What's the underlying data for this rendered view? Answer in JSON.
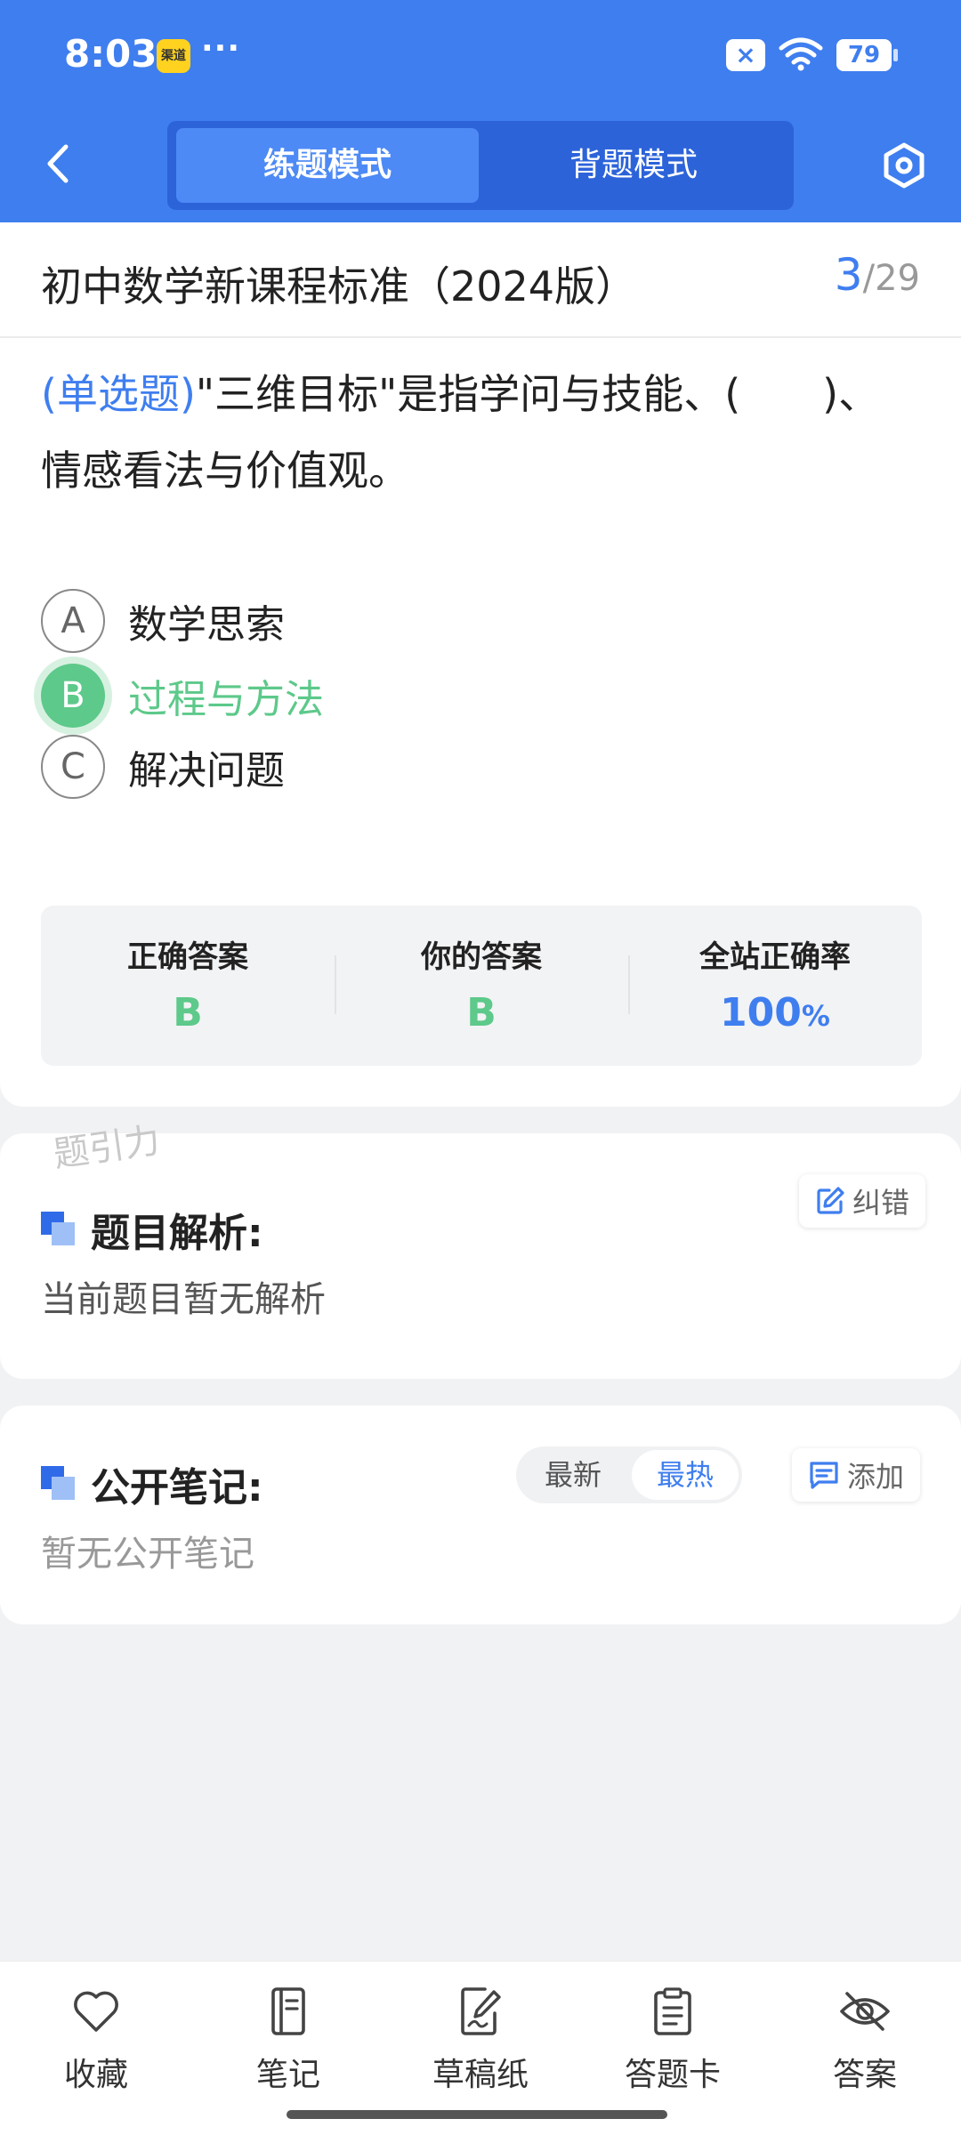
{
  "status_bar": {
    "time": "8:03",
    "app_badge": "渠道",
    "dots": "···",
    "battery": "79"
  },
  "header": {
    "modes": {
      "active": "练题模式",
      "inactive": "背题模式"
    }
  },
  "question": {
    "course": "初中数学新课程标准（2024版）",
    "current": "3",
    "separator": "/",
    "total": "29",
    "type": "(单选题)",
    "line1": "\"三维目标\"是指学问与技能、(　　)、",
    "line2": "情感看法与价值观。",
    "options": [
      {
        "letter": "A",
        "text": "数学思索"
      },
      {
        "letter": "B",
        "text": "过程与方法"
      },
      {
        "letter": "C",
        "text": "解决问题"
      }
    ],
    "results": {
      "correct_label": "正确答案",
      "correct_value": "B",
      "yours_label": "你的答案",
      "yours_value": "B",
      "rate_label": "全站正确率",
      "rate_value": "100",
      "rate_unit": "%"
    }
  },
  "analysis": {
    "watermark": "题引力",
    "title": "题目解析:",
    "report_label": "纠错",
    "content": "当前题目暂无解析"
  },
  "notes": {
    "title": "公开笔记:",
    "sort_latest": "最新",
    "sort_hot": "最热",
    "add_label": "添加",
    "empty": "暂无公开笔记"
  },
  "toolbar": {
    "favorite": "收藏",
    "notes": "笔记",
    "draft": "草稿纸",
    "answer_card": "答题卡",
    "answer": "答案"
  },
  "colors": {
    "primary": "#3f7eef",
    "correct": "#5dc98a"
  }
}
